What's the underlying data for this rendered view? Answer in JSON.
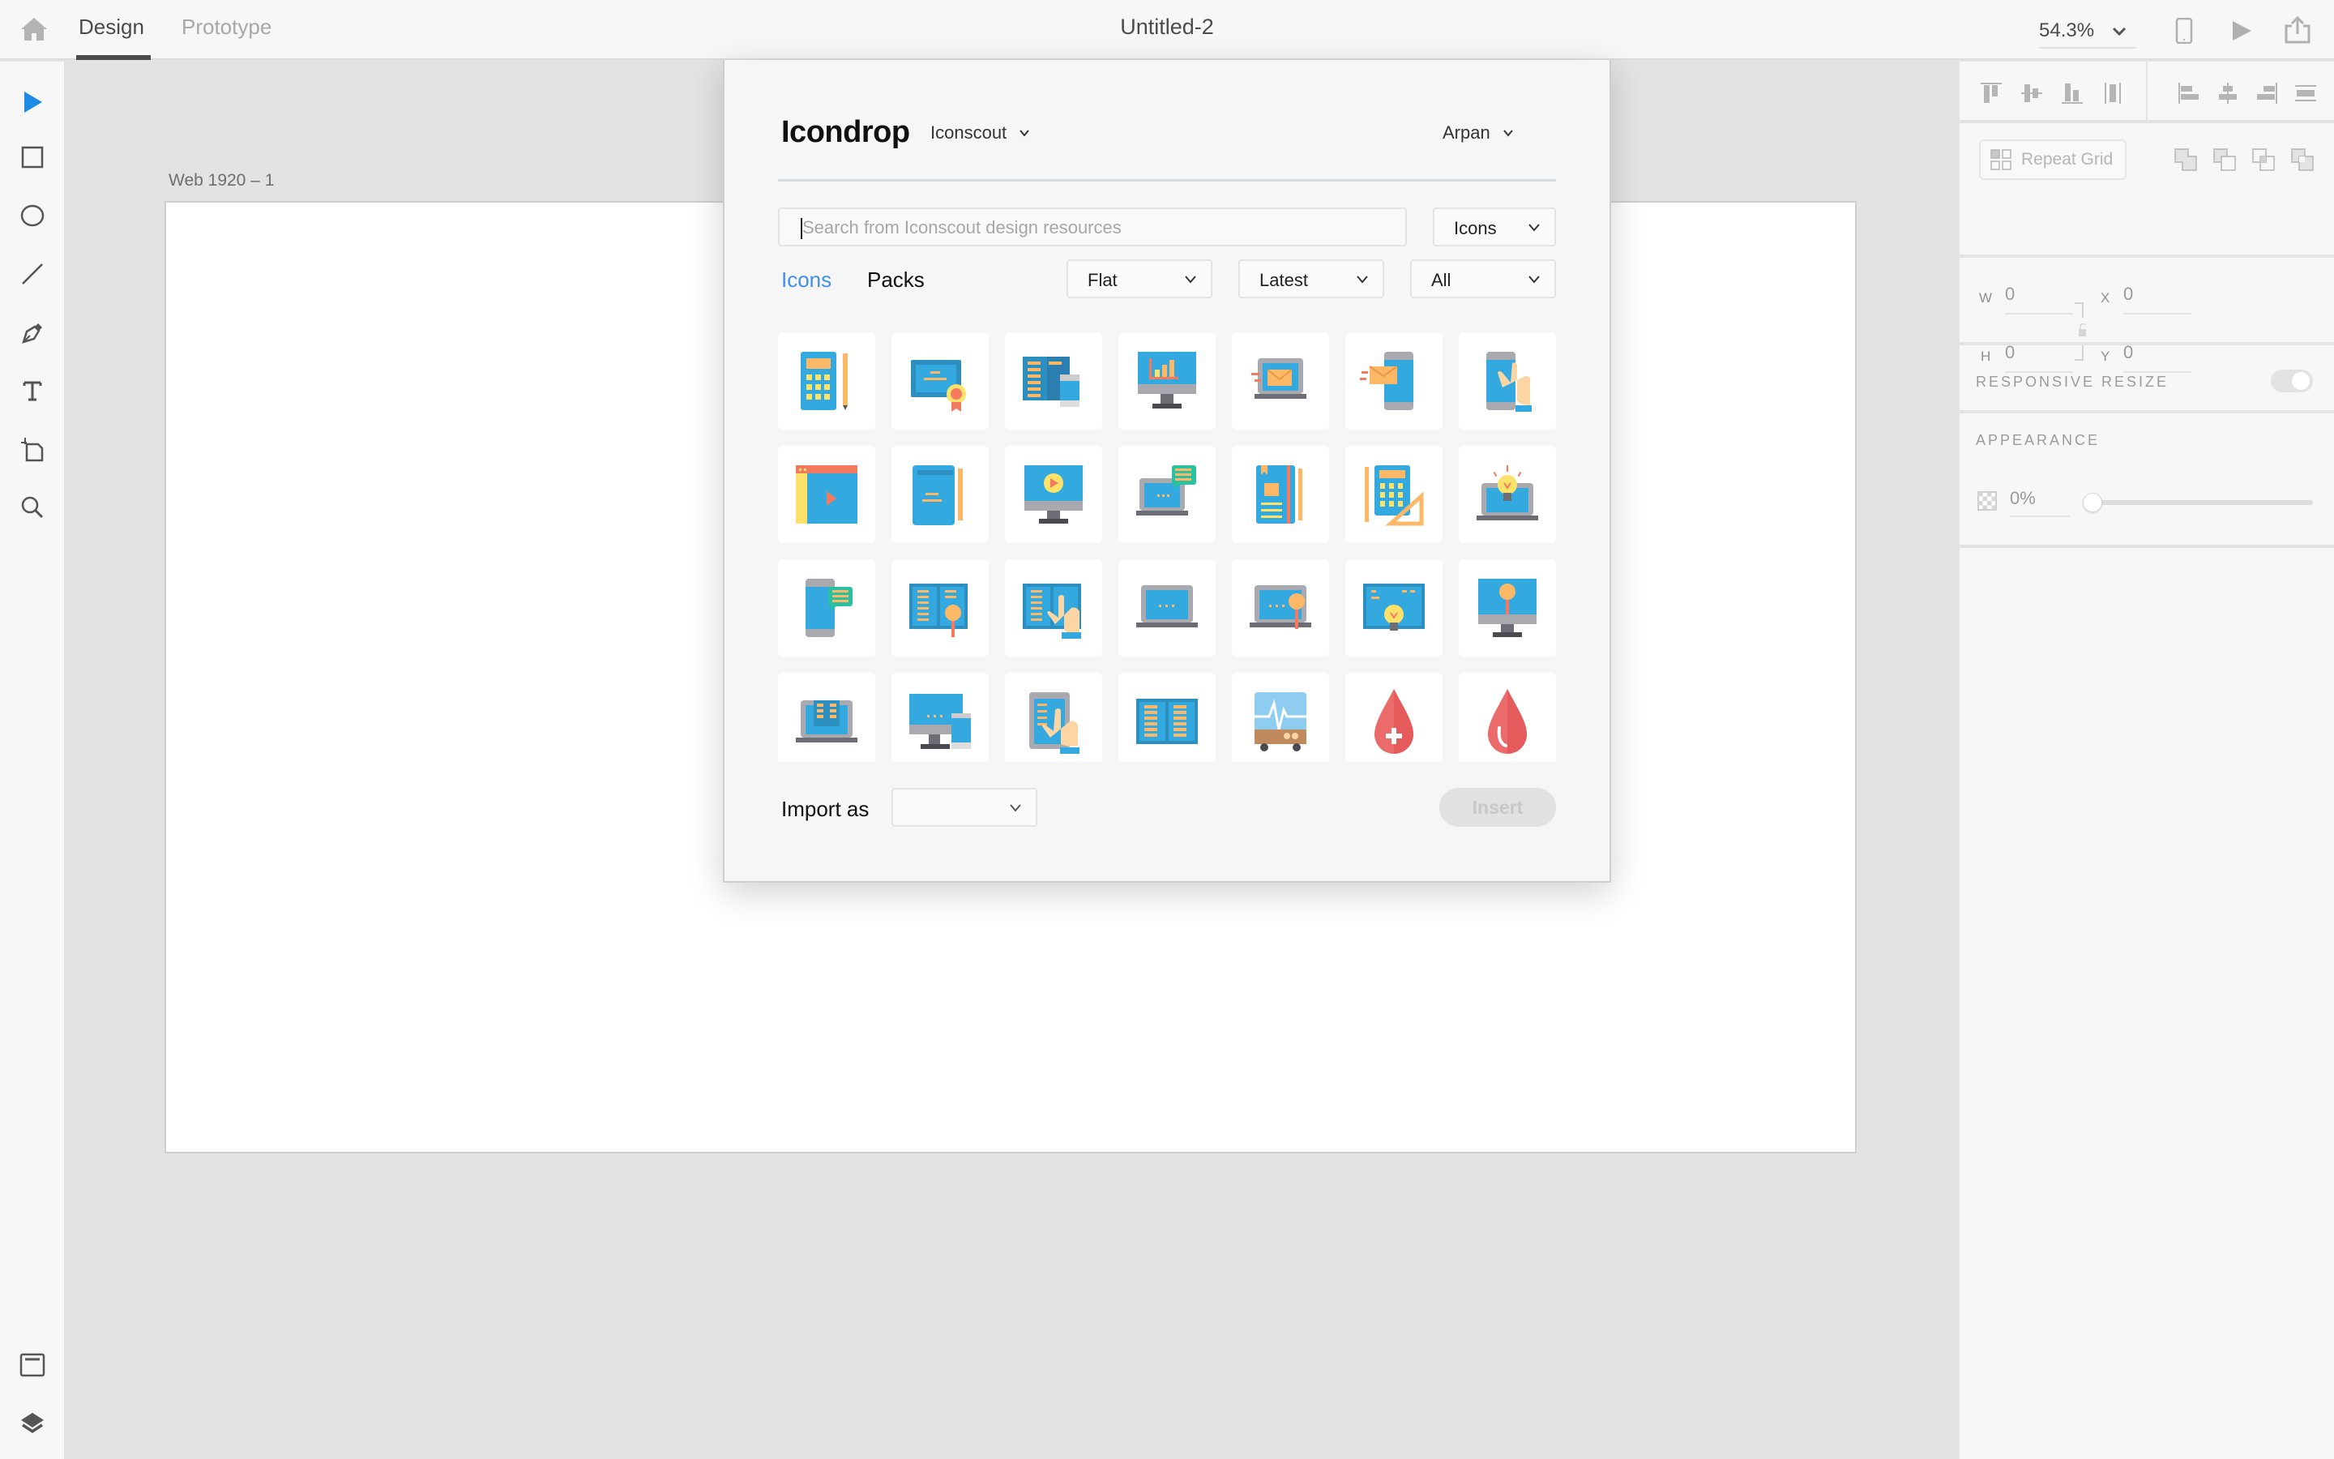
{
  "header": {
    "tabs": [
      {
        "label": "Design",
        "active": true
      },
      {
        "label": "Prototype",
        "active": false
      }
    ],
    "document_title": "Untitled-2",
    "zoom_level": "54.3%",
    "icons": [
      "home-icon",
      "device-preview-icon",
      "play-icon",
      "share-icon"
    ]
  },
  "toolbar": {
    "tools": [
      {
        "name": "select-tool",
        "active": true
      },
      {
        "name": "rectangle-tool"
      },
      {
        "name": "ellipse-tool"
      },
      {
        "name": "line-tool"
      },
      {
        "name": "pen-tool"
      },
      {
        "name": "text-tool"
      },
      {
        "name": "artboard-tool"
      },
      {
        "name": "zoom-tool"
      }
    ],
    "bottom": [
      "assets-panel",
      "layers-panel"
    ],
    "accent": "#1473e6"
  },
  "canvas": {
    "artboard_label": "Web 1920 – 1"
  },
  "plugin": {
    "brand": "Icondrop",
    "source_dropdown": "Iconscout",
    "user_dropdown": "Arpan",
    "search": {
      "value": "",
      "placeholder": "Search from Iconscout design resources"
    },
    "type_select": "Icons",
    "subtabs": [
      {
        "label": "Icons",
        "active": true
      },
      {
        "label": "Packs",
        "active": false
      }
    ],
    "filters": [
      {
        "name": "style",
        "value": "Flat"
      },
      {
        "name": "sort",
        "value": "Latest"
      },
      {
        "name": "price",
        "value": "All"
      }
    ],
    "active_color": "#3d8ff0",
    "icon_grid": [
      [
        "calculator-pencil",
        "certificate",
        "book-phone",
        "monitor-chart",
        "laptop-mail",
        "phone-mail",
        "phone-touch"
      ],
      [
        "video-window",
        "notebook-pencil",
        "monitor-video",
        "laptop-chat",
        "notebook-bookmark",
        "calculator-ruler",
        "laptop-idea"
      ],
      [
        "phone-chat",
        "book-search",
        "book-touch",
        "laptop",
        "laptop-search",
        "book-idea",
        "monitor-search"
      ],
      [
        "laptop-ebook",
        "monitor-phone",
        "tablet-touch",
        "open-book",
        "ekg-monitor",
        "blood-drop-plus",
        "blood-drop"
      ]
    ],
    "import_label": "Import as",
    "import_select": "",
    "insert_label": "Insert",
    "insert_enabled": false
  },
  "properties": {
    "repeat_grid_label": "Repeat Grid",
    "dimensions": {
      "w": "0",
      "h": "0",
      "x": "0",
      "y": "0"
    },
    "dimension_labels": {
      "w": "W",
      "h": "H",
      "x": "X",
      "y": "Y"
    },
    "responsive_resize_label": "RESPONSIVE RESIZE",
    "responsive_resize_on": false,
    "appearance_label": "APPEARANCE",
    "opacity": "0%"
  }
}
